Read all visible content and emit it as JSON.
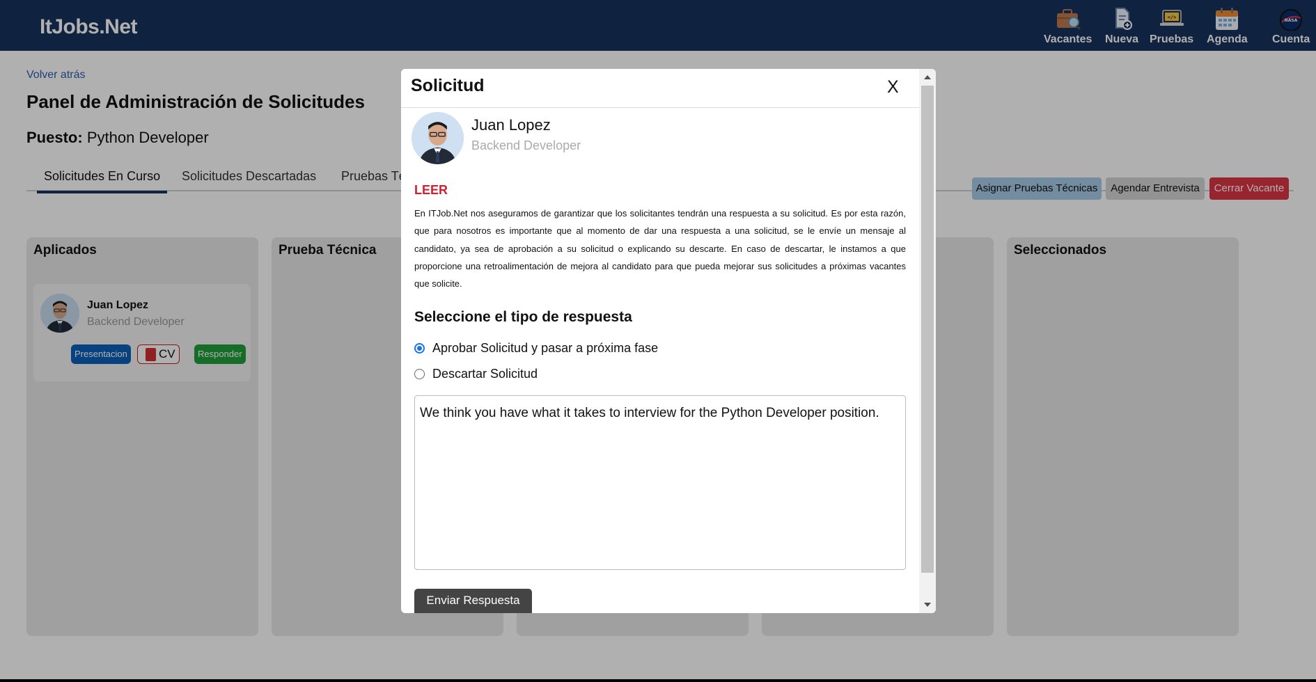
{
  "navbar": {
    "brand": "ItJobs.Net",
    "items": [
      {
        "label": "Vacantes",
        "icon": "briefcase-search-icon"
      },
      {
        "label": "Nueva",
        "icon": "new-document-icon"
      },
      {
        "label": "Pruebas",
        "icon": "laptop-code-icon"
      },
      {
        "label": "Agenda",
        "icon": "calendar-icon"
      },
      {
        "label": "Cuenta",
        "icon": "account-avatar-icon"
      }
    ]
  },
  "page": {
    "back_link": "Volver atrás",
    "title": "Panel de Administración de Solicitudes",
    "position_label": "Puesto:",
    "position_value": "Python Developer",
    "tabs": [
      "Solicitudes En Curso",
      "Solicitudes Descartadas",
      "Pruebas Té"
    ],
    "actions": {
      "assign_tests": "Asignar Pruebas Técnicas",
      "schedule_interview": "Agendar Entrevista",
      "close_vacancy": "Cerrar Vacante"
    },
    "columns": [
      {
        "title": "Aplicados"
      },
      {
        "title": "Prueba Técnica"
      },
      {
        "title": ""
      },
      {
        "title": ""
      },
      {
        "title": "Seleccionados"
      }
    ],
    "card": {
      "name": "Juan Lopez",
      "role": "Backend Developer",
      "presentation_label": "Presentacion",
      "cv_label": "CV",
      "respond_label": "Responder"
    }
  },
  "modal": {
    "title": "Solicitud",
    "close_label": "X",
    "applicant_name": "Juan Lopez",
    "applicant_role": "Backend Developer",
    "read_label": "LEER",
    "notice": "En ITJob.Net nos aseguramos de garantizar que los solicitantes tendrán una respuesta a su solicitud. Es por esta razón, que para nosotros es importante que al momento de dar una respuesta a una solicitud, se le envíe un mensaje al candidato, ya sea de aprobación a su solicitud o explicando su descarte. En caso de descartar, le instamos a que proporcione una retroalimentación de mejora al candidato para que pueda mejorar sus solicitudes a próximas vacantes que solicite.",
    "response_type_title": "Seleccione el tipo de respuesta",
    "options": [
      {
        "label": "Aprobar Solicitud y pasar a próxima fase",
        "checked": true
      },
      {
        "label": "Descartar Solicitud",
        "checked": false
      }
    ],
    "message": "We think you have what it takes to interview for the Python Developer position.",
    "send_label": "Enviar Respuesta"
  },
  "colors": {
    "navbar": "#17325c",
    "danger": "#dc3545",
    "primary": "#0d5fb8",
    "success": "#1f9e3a",
    "accent_blue": "#a9cbe8"
  }
}
